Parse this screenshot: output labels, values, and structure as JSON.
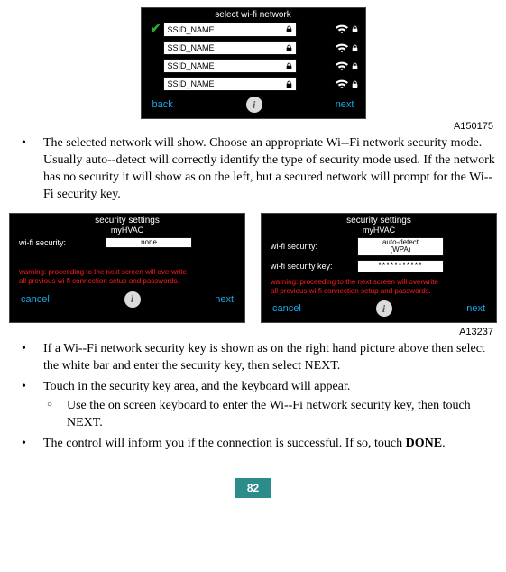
{
  "screen1": {
    "title": "select wi-fi network",
    "items": [
      {
        "ssid": "SSID_NAME",
        "checked": true,
        "locked": true
      },
      {
        "ssid": "SSID_NAME",
        "checked": false,
        "locked": true
      },
      {
        "ssid": "SSID_NAME",
        "checked": false,
        "locked": true
      },
      {
        "ssid": "SSID_NAME",
        "checked": false,
        "locked": true
      }
    ],
    "back": "back",
    "next": "next",
    "figure_id": "A150175"
  },
  "bullet1": "The selected network will show.  Choose an appropriate Wi--Fi network security mode.  Usually auto--detect will correctly identify the type of security mode used.  If the network has no security it will show as on the left, but a secured network will prompt for the Wi--Fi security key.",
  "screen2_left": {
    "title": "security settings",
    "subtitle": "myHVAC",
    "rows": [
      {
        "label": "wi-fi security:",
        "value": "none"
      }
    ],
    "warning_l1": "warning:  proceeding to the next screen will overwrite",
    "warning_l2": "all previous wi-fi connection setup and passwords.",
    "cancel": "cancel",
    "next": "next"
  },
  "screen2_right": {
    "title": "security settings",
    "subtitle": "myHVAC",
    "rows": [
      {
        "label": "wi-fi security:",
        "value": "auto-detect\n(WPA)"
      },
      {
        "label": "wi-fi security key:",
        "value": "***********"
      }
    ],
    "warning_l1": "warning:  proceeding to the next screen will overwrite",
    "warning_l2": "all previous wi-fi connection setup and passwords.",
    "cancel": "cancel",
    "next": "next"
  },
  "figure_id_2": "A13237",
  "bullet2": "If a Wi--Fi network security key is shown as on the right hand picture above then select the white bar and enter the security key, then select NEXT.",
  "bullet3": "Touch in the security key area, and the keyboard will appear.",
  "bullet3a": "Use the on screen keyboard to enter the Wi--Fi network security key, then touch NEXT.",
  "bullet4_a": "The control will inform you if the connection is successful. If so, touch ",
  "bullet4_b": "DONE",
  "bullet4_c": ".",
  "page_number": "82"
}
